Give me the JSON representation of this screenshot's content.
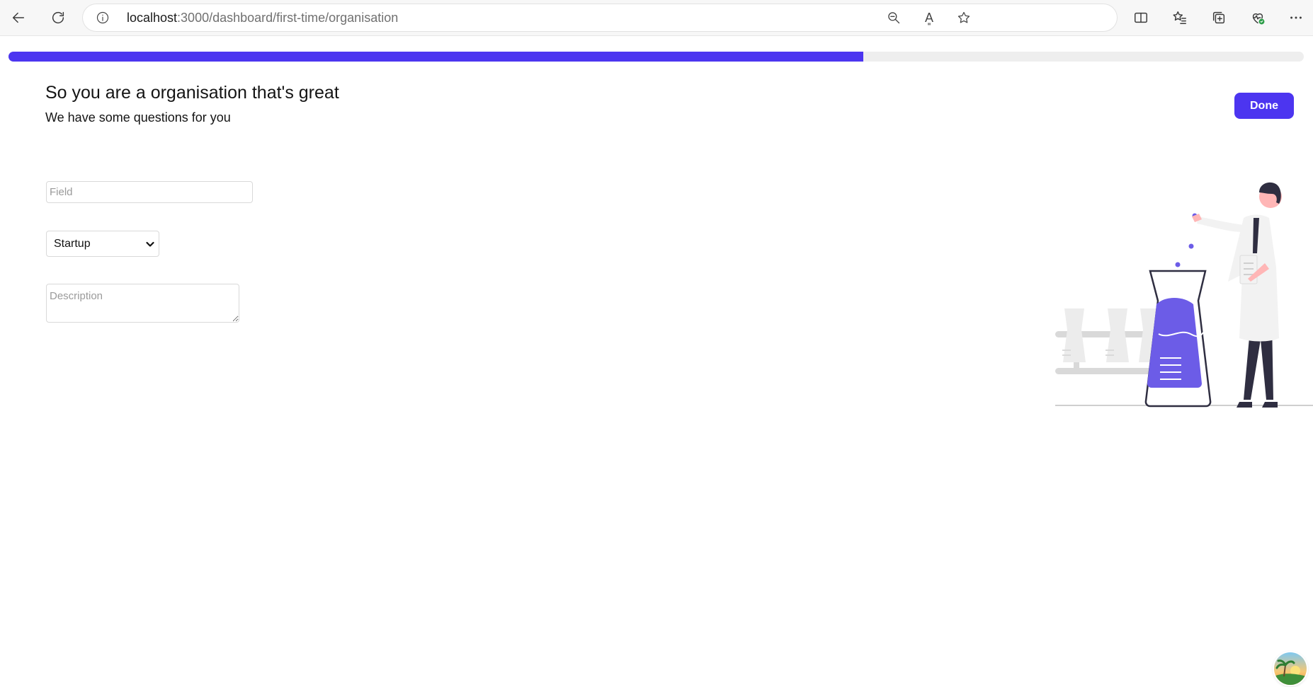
{
  "browser": {
    "url_host": "localhost",
    "url_path": ":3000/dashboard/first-time/organisation",
    "read_aloud_glyph": "A͈"
  },
  "progress": {
    "value_percent": 66,
    "color": "#4c35f0"
  },
  "header": {
    "title": "So you are a organisation that's great",
    "subtitle": "We have some questions for you"
  },
  "actions": {
    "done_label": "Done"
  },
  "form": {
    "field_placeholder": "Field",
    "field_value": "",
    "type_selected": "Startup",
    "description_placeholder": "Description",
    "description_value": ""
  },
  "illustration": {
    "name": "scientist-with-flask",
    "accent_color": "#6c5ce7"
  }
}
